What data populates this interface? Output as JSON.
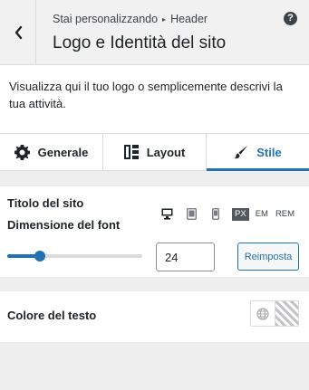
{
  "header": {
    "breadcrumb_prefix": "Stai personalizzando",
    "breadcrumb_section": "Header",
    "title": "Logo e Identità del sito",
    "help_icon": "question-circle-icon",
    "back_icon": "chevron-left-icon"
  },
  "description": "Visualizza qui il tuo logo o semplicemente descrivi la tua attività.",
  "tabs": [
    {
      "label": "Generale",
      "icon": "gear-icon"
    },
    {
      "label": "Layout",
      "icon": "layout-grid-icon"
    },
    {
      "label": "Stile",
      "icon": "paintbrush-icon",
      "active": true
    }
  ],
  "site_title": {
    "heading": "Titolo del sito",
    "font_size_label": "Dimensione del font",
    "devices": [
      "desktop-icon",
      "tablet-icon",
      "mobile-icon"
    ],
    "units": [
      "PX",
      "EM",
      "REM"
    ],
    "active_unit": "PX",
    "slider_fraction": 0.24,
    "value": "24",
    "reset_label": "Reimposta"
  },
  "text_color": {
    "label": "Colore del testo",
    "icon": "globe-icon"
  },
  "colors": {
    "accent": "#2271b1",
    "header_bg": "#f1f1f1",
    "panel_bg": "#eeeeee"
  }
}
